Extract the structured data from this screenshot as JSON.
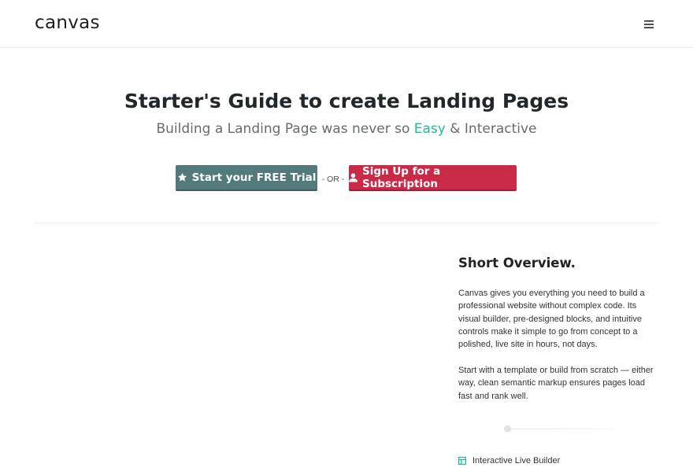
{
  "header": {
    "logo_text": "canvas",
    "menu_icon": "hamburger-menu-icon"
  },
  "hero": {
    "title": "Starter's Guide to create Landing Pages",
    "subtitle_before": "Building a Landing Page was never so ",
    "subtitle_accent": "Easy",
    "subtitle_after": " & Interactive",
    "accent_color": "#1abc9c"
  },
  "cta": {
    "trial_label": "Start your FREE Trial",
    "trial_icon": "star-icon",
    "trial_color": "#537a7a",
    "or_text": "- OR -",
    "signup_label": "Sign Up for a Subscription",
    "signup_icon": "user-icon",
    "signup_color": "#c82a47"
  },
  "overview": {
    "title": "Short Overview.",
    "paragraph_1": "Canvas gives you everything you need to build a professional website without complex code. Its visual builder, pre-designed blocks, and intuitive controls make it simple to go from concept to a polished, live site in hours, not days.",
    "paragraph_2": "Start with a template or build from scratch — either way, clean semantic markup ensures pages load fast and rank well.",
    "features": [
      {
        "icon": "layout-icon",
        "label": "Interactive Live Builder",
        "icon_color": "#1abc9c"
      }
    ]
  }
}
